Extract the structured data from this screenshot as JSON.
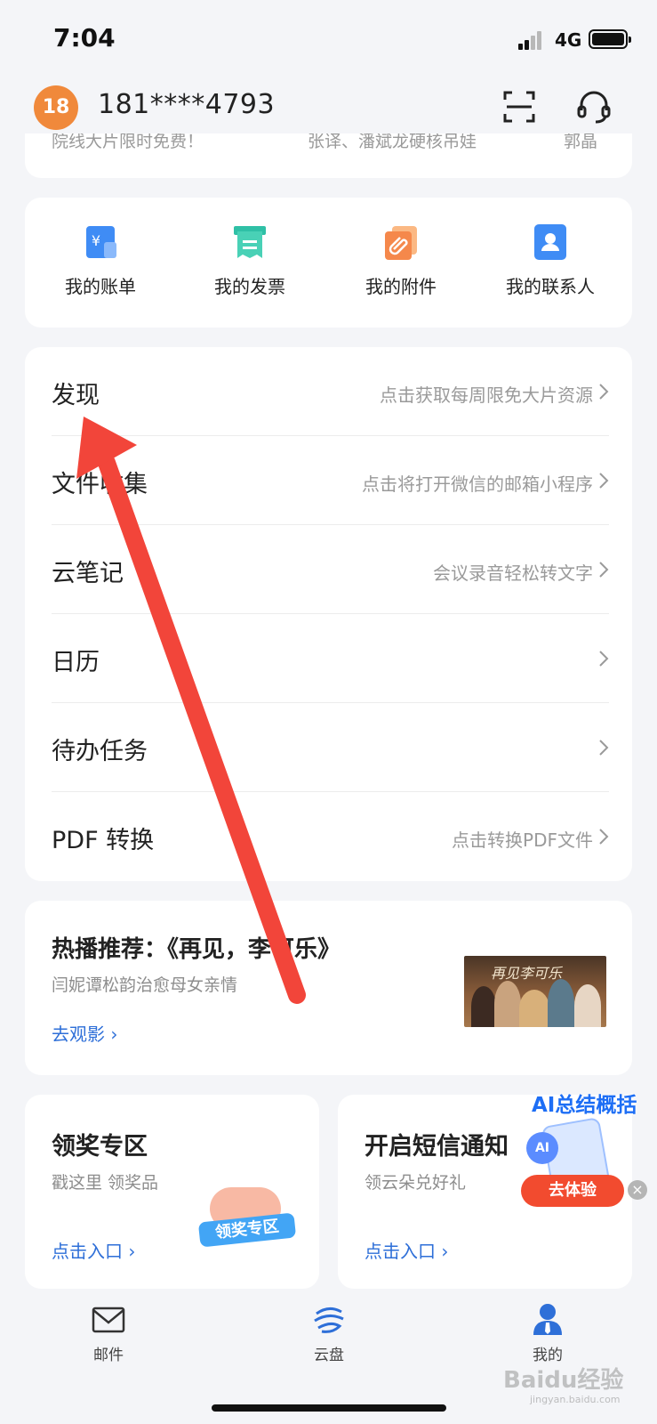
{
  "status_bar": {
    "time": "7:04",
    "network": "4G",
    "battery_level": 0.95
  },
  "header": {
    "avatar_text": "18",
    "account": "181****4793",
    "icons": [
      "scan-icon",
      "customer-service-icon"
    ]
  },
  "peek_card": {
    "items": [
      "院线大片限时免费！",
      "张译、潘斌龙硬核吊娃",
      "郭晶"
    ]
  },
  "shortcuts": [
    {
      "label": "我的账单",
      "icon": "bill-icon",
      "color": "#3f8cf5"
    },
    {
      "label": "我的发票",
      "icon": "invoice-icon",
      "color": "#2fc0a6"
    },
    {
      "label": "我的附件",
      "icon": "attachment-icon",
      "color": "#f5884b"
    },
    {
      "label": "我的联系人",
      "icon": "contact-icon",
      "color": "#3f8cf5"
    }
  ],
  "menu": [
    {
      "title": "发现",
      "hint": "点击获取每周限免大片资源"
    },
    {
      "title": "文件收集",
      "hint": "点击将打开微信的邮箱小程序"
    },
    {
      "title": "云笔记",
      "hint": "会议录音轻松转文字"
    },
    {
      "title": "日历",
      "hint": ""
    },
    {
      "title": "待办任务",
      "hint": ""
    },
    {
      "title": "PDF 转换",
      "hint": "点击转换PDF文件"
    }
  ],
  "promo": {
    "title": "热播推荐：《再见，李可乐》",
    "subtitle": "闫妮谭松韵治愈母女亲情",
    "link": "去观影 ›",
    "poster_title": "再见李可乐"
  },
  "tiles": [
    {
      "title": "领奖专区",
      "subtitle": "戳这里 领奖品",
      "link": "点击入口 ›",
      "art_text": "领奖专区"
    },
    {
      "title": "开启短信通知",
      "subtitle": "领云朵兑好礼",
      "link": "点击入口 ›"
    }
  ],
  "ai_float": {
    "badge": "AI总结概括",
    "bubble": "AI",
    "button": "去体验",
    "close": "×"
  },
  "tabbar": [
    {
      "label": "邮件",
      "icon": "mail-icon"
    },
    {
      "label": "云盘",
      "icon": "cloud-drive-icon"
    },
    {
      "label": "我的",
      "icon": "profile-icon",
      "active": true
    }
  ],
  "watermark": {
    "text": "Baidu经验",
    "sub": "jingyan.baidu.com"
  },
  "colors": {
    "accent": "#2e6fd8",
    "arrow": "#f2453a",
    "avatar": "#f0893b"
  }
}
